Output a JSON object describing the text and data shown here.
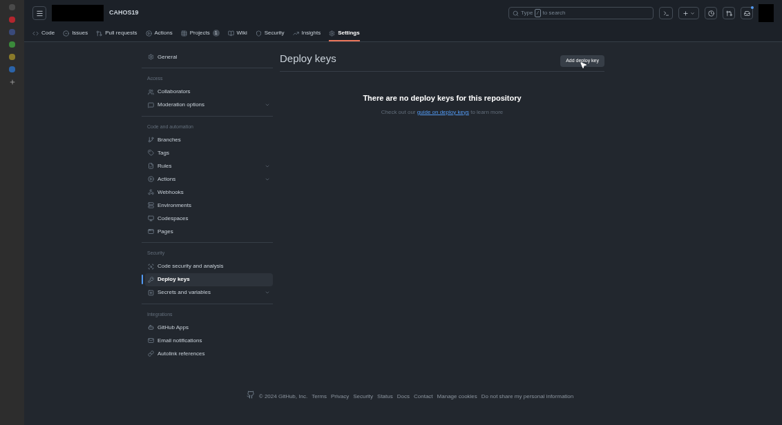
{
  "dock": [
    {
      "color": "#4a4a4a"
    },
    {
      "color": "#b3262e"
    },
    {
      "color": "#3a4a7a"
    },
    {
      "color": "#3b8a3b"
    },
    {
      "color": "#8a7a2a"
    },
    {
      "color": "#2b63a8"
    }
  ],
  "header": {
    "repo": "CAHOS19",
    "search": {
      "placeholder_parts": [
        "Type",
        "/",
        "to search"
      ]
    }
  },
  "tabs": [
    {
      "label": "Code",
      "selected": false
    },
    {
      "label": "Issues",
      "selected": false
    },
    {
      "label": "Pull requests",
      "selected": false
    },
    {
      "label": "Actions",
      "selected": false
    },
    {
      "label": "Projects",
      "count": "1",
      "selected": false
    },
    {
      "label": "Wiki",
      "selected": false
    },
    {
      "label": "Security",
      "selected": false
    },
    {
      "label": "Insights",
      "selected": false
    },
    {
      "label": "Settings",
      "selected": true
    }
  ],
  "sidebar": [
    {
      "items": [
        {
          "label": "General",
          "chevron": false,
          "selected": false
        }
      ]
    },
    {
      "heading": "Access",
      "items": [
        {
          "label": "Collaborators",
          "chevron": false,
          "selected": false
        },
        {
          "label": "Moderation options",
          "chevron": true,
          "selected": false
        }
      ]
    },
    {
      "heading": "Code and automation",
      "items": [
        {
          "label": "Branches",
          "chevron": false,
          "selected": false
        },
        {
          "label": "Tags",
          "chevron": false,
          "selected": false
        },
        {
          "label": "Rules",
          "chevron": true,
          "selected": false
        },
        {
          "label": "Actions",
          "chevron": true,
          "selected": false
        },
        {
          "label": "Webhooks",
          "chevron": false,
          "selected": false
        },
        {
          "label": "Environments",
          "chevron": false,
          "selected": false
        },
        {
          "label": "Codespaces",
          "chevron": false,
          "selected": false
        },
        {
          "label": "Pages",
          "chevron": false,
          "selected": false
        }
      ]
    },
    {
      "heading": "Security",
      "items": [
        {
          "label": "Code security and analysis",
          "chevron": false,
          "selected": false
        },
        {
          "label": "Deploy keys",
          "chevron": false,
          "selected": true
        },
        {
          "label": "Secrets and variables",
          "chevron": true,
          "selected": false
        }
      ]
    },
    {
      "heading": "Integrations",
      "items": [
        {
          "label": "GitHub Apps",
          "chevron": false,
          "selected": false
        },
        {
          "label": "Email notifications",
          "chevron": false,
          "selected": false
        },
        {
          "label": "Autolink references",
          "chevron": false,
          "selected": false
        }
      ]
    }
  ],
  "main": {
    "title": "Deploy keys",
    "button": "Add deploy key",
    "empty_title": "There are no deploy keys for this repository",
    "empty_before": "Check out our",
    "empty_link": "guide on deploy keys",
    "empty_after": "to learn more"
  },
  "footer": {
    "copyright": "© 2024 GitHub, Inc.",
    "links": [
      "Terms",
      "Privacy",
      "Security",
      "Status",
      "Docs",
      "Contact",
      "Manage cookies",
      "Do not share my personal information"
    ]
  }
}
